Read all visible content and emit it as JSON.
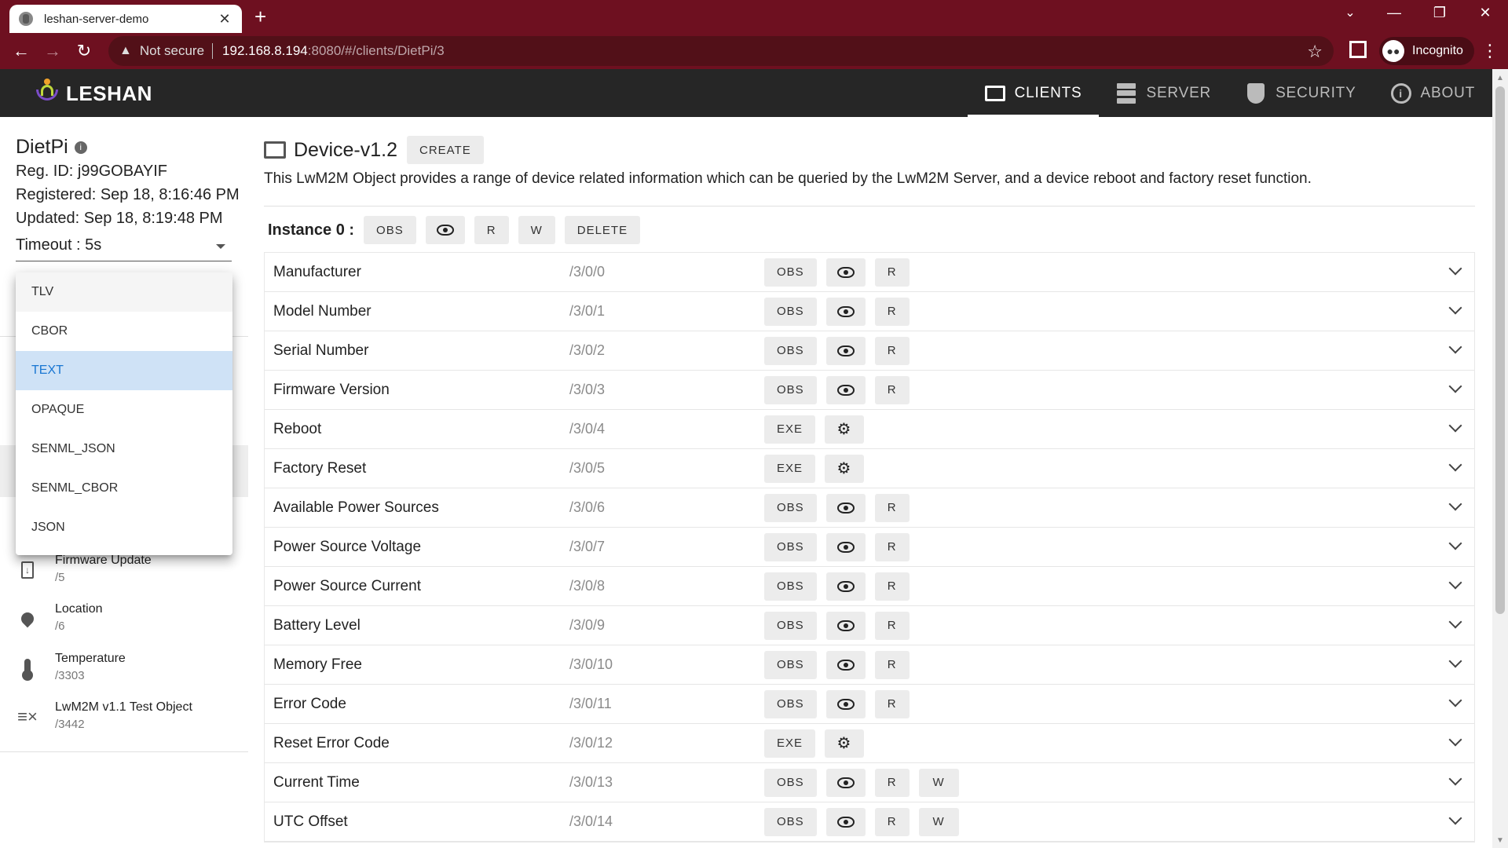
{
  "browser": {
    "tab_title": "leshan-server-demo",
    "not_secure": "Not secure",
    "url_host": "192.168.8.194",
    "url_rest": ":8080/#/clients/DietPi/3",
    "incognito": "Incognito"
  },
  "appbar": {
    "logo": "LESHAN",
    "nav": [
      {
        "label": "CLIENTS",
        "icon": "clients-icon"
      },
      {
        "label": "SERVER",
        "icon": "server-icon"
      },
      {
        "label": "SECURITY",
        "icon": "security-icon"
      },
      {
        "label": "ABOUT",
        "icon": "about-icon"
      }
    ]
  },
  "client": {
    "name": "DietPi",
    "reg_id": "Reg. ID: j99GOBAYIF",
    "registered": "Registered: Sep 18, 8:16:46 PM",
    "updated": "Updated: Sep 18, 8:19:48 PM",
    "timeout": "Timeout : 5s"
  },
  "format_menu": {
    "options": [
      "TLV",
      "CBOR",
      "TEXT",
      "OPAQUE",
      "SENML_JSON",
      "SENML_CBOR",
      "JSON"
    ],
    "selected": "TEXT"
  },
  "objects": [
    {
      "name": "Firmware Update",
      "path": "/5",
      "icon": "firmware-icon"
    },
    {
      "name": "Location",
      "path": "/6",
      "icon": "location-icon"
    },
    {
      "name": "Temperature",
      "path": "/3303",
      "icon": "thermometer-icon"
    },
    {
      "name": "LwM2M v1.1 Test Object",
      "path": "/3442",
      "icon": "test-object-icon"
    }
  ],
  "object": {
    "title": "Device-v1.2",
    "create": "CREATE",
    "description": "This LwM2M Object provides a range of device related information which can be queried by the LwM2M Server, and a device reboot and factory reset function."
  },
  "instance": {
    "label": "Instance 0 :",
    "obs": "OBS",
    "r": "R",
    "w": "W",
    "delete": "DELETE"
  },
  "resources": [
    {
      "name": "Manufacturer",
      "path": "/3/0/0",
      "kind": "read"
    },
    {
      "name": "Model Number",
      "path": "/3/0/1",
      "kind": "read"
    },
    {
      "name": "Serial Number",
      "path": "/3/0/2",
      "kind": "read"
    },
    {
      "name": "Firmware Version",
      "path": "/3/0/3",
      "kind": "read"
    },
    {
      "name": "Reboot",
      "path": "/3/0/4",
      "kind": "exec"
    },
    {
      "name": "Factory Reset",
      "path": "/3/0/5",
      "kind": "exec"
    },
    {
      "name": "Available Power Sources",
      "path": "/3/0/6",
      "kind": "read"
    },
    {
      "name": "Power Source Voltage",
      "path": "/3/0/7",
      "kind": "read"
    },
    {
      "name": "Power Source Current",
      "path": "/3/0/8",
      "kind": "read"
    },
    {
      "name": "Battery Level",
      "path": "/3/0/9",
      "kind": "read"
    },
    {
      "name": "Memory Free",
      "path": "/3/0/10",
      "kind": "read"
    },
    {
      "name": "Error Code",
      "path": "/3/0/11",
      "kind": "read"
    },
    {
      "name": "Reset Error Code",
      "path": "/3/0/12",
      "kind": "exec"
    },
    {
      "name": "Current Time",
      "path": "/3/0/13",
      "kind": "readwrite"
    },
    {
      "name": "UTC Offset",
      "path": "/3/0/14",
      "kind": "readwrite"
    }
  ],
  "buttons": {
    "obs": "OBS",
    "r": "R",
    "w": "W",
    "exe": "EXE"
  }
}
